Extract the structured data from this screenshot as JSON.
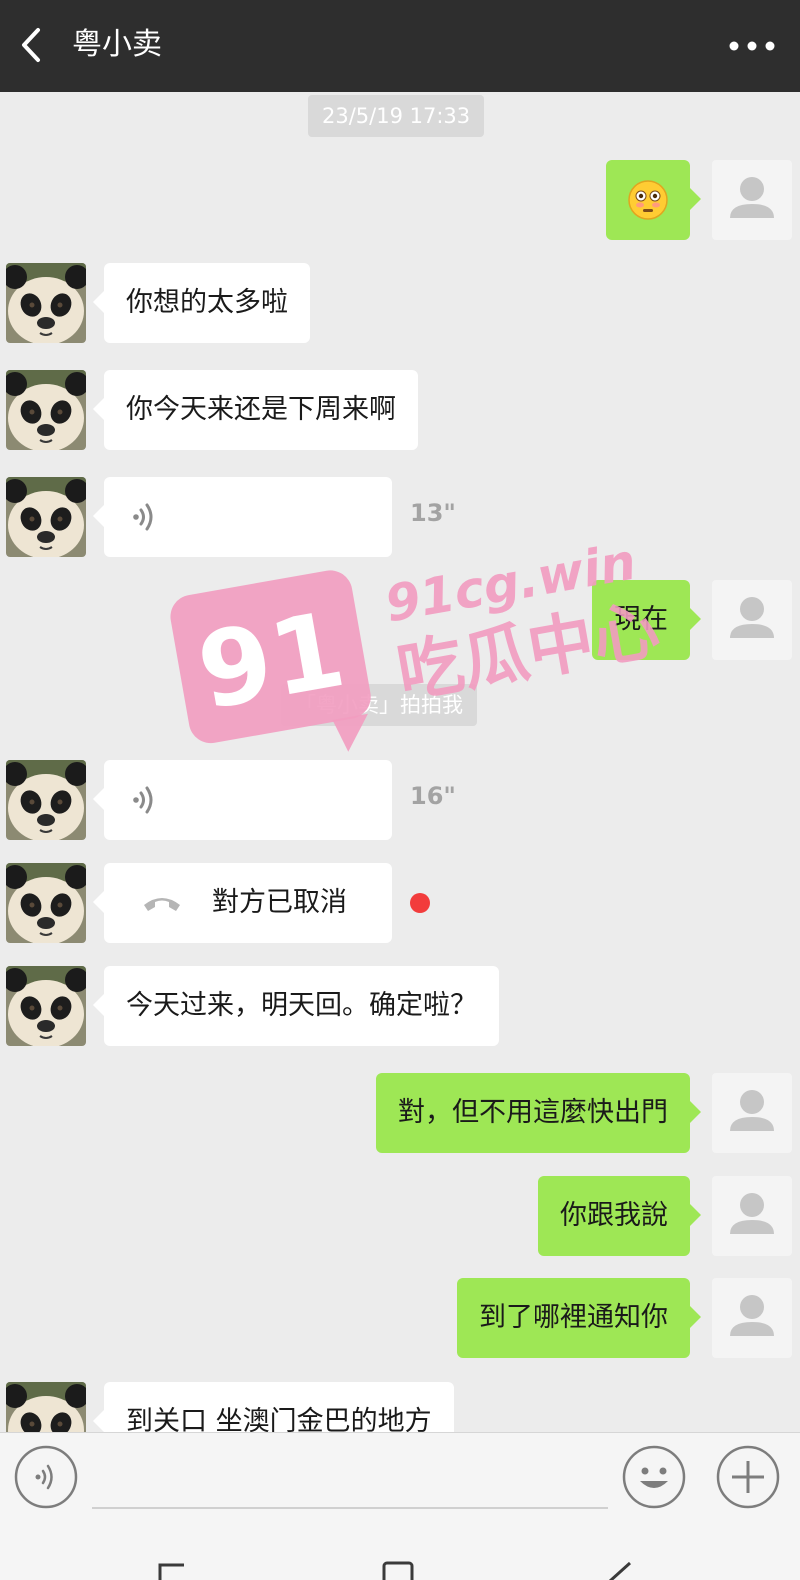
{
  "header": {
    "title": "粤小卖",
    "back_icon": "chevron-left-icon",
    "more_icon": "more-dots-icon"
  },
  "timestamp": "23/5/19 17:33",
  "system_notice": "「粤小卖」拍拍我",
  "messages": {
    "m1": {
      "side": "out",
      "type": "emoji",
      "text": "😳"
    },
    "m2": {
      "side": "in",
      "type": "text",
      "text": "你想的太多啦"
    },
    "m3": {
      "side": "in",
      "type": "text",
      "text": "你今天来还是下周来啊"
    },
    "m4": {
      "side": "in",
      "type": "voice",
      "duration": "13\""
    },
    "m5": {
      "side": "out",
      "type": "text",
      "text": "現在"
    },
    "m6": {
      "side": "in",
      "type": "voice",
      "duration": "16\""
    },
    "m7": {
      "side": "in",
      "type": "call",
      "text": "對方已取消"
    },
    "m8": {
      "side": "in",
      "type": "text",
      "text": "今天过来，明天回。确定啦？"
    },
    "m9": {
      "side": "out",
      "type": "text",
      "text": "對，但不用這麼快出門"
    },
    "m10": {
      "side": "out",
      "type": "text",
      "text": "你跟我說"
    },
    "m11": {
      "side": "out",
      "type": "text",
      "text": "到了哪裡通知你"
    },
    "m12": {
      "side": "in",
      "type": "text",
      "text": "到关口 坐澳门金巴的地方"
    }
  },
  "watermark": {
    "badge": "91",
    "domain": "91cg.win",
    "slogan": "吃瓜中心",
    "color": "#f29cc0"
  },
  "colors": {
    "header_bg": "#2e2e2e",
    "chat_bg": "#ececec",
    "outgoing_bubble": "#9ee755",
    "incoming_bubble": "#ffffff",
    "missed_call_dot": "#f23c3c"
  },
  "input_bar": {
    "voice_icon": "voice-toggle-icon",
    "emoji_icon": "smiley-icon",
    "plus_icon": "plus-icon",
    "message_value": ""
  }
}
